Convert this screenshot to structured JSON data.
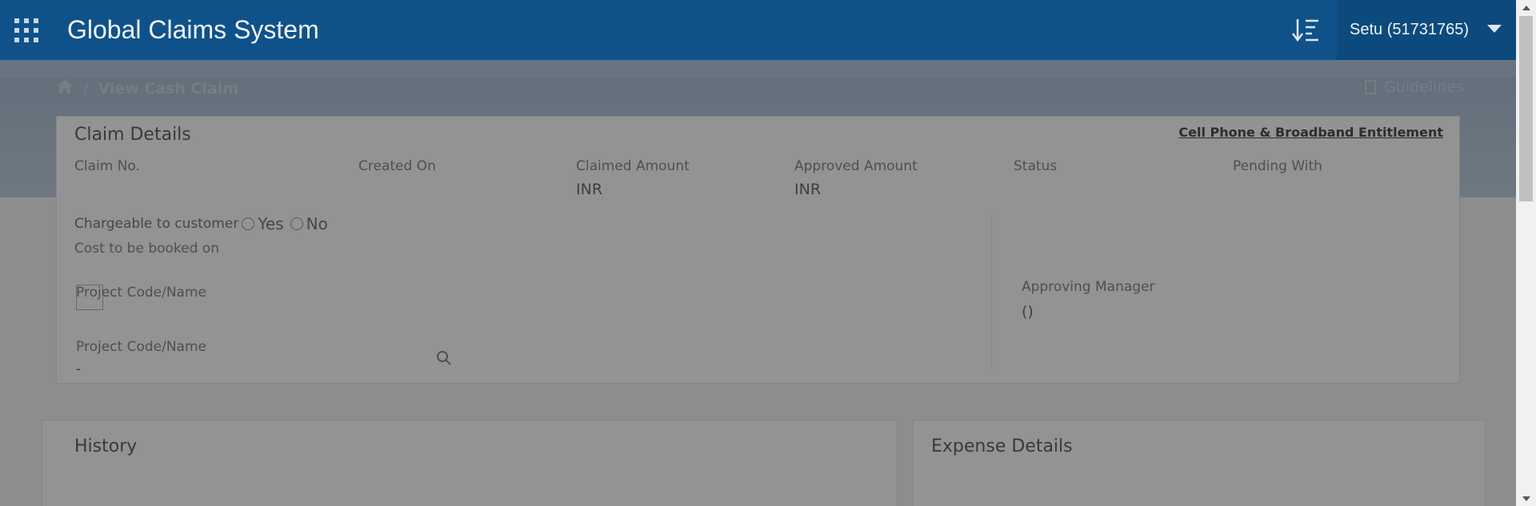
{
  "header": {
    "title": "Global Claims System",
    "user": "Setu (51731765)"
  },
  "breadcrumb": {
    "separator": "/",
    "current": "View Cash Claim"
  },
  "guidelines_label": "Guidelines",
  "claim_details": {
    "title": "Claim Details",
    "entitlement_link": "Cell Phone & Broadband Entitlement",
    "fields": {
      "claim_no": "Claim No.",
      "created_on": "Created On",
      "claimed_amount": "Claimed Amount",
      "approved_amount": "Approved Amount",
      "status": "Status",
      "pending_with": "Pending With"
    },
    "claimed_amount_value": "INR",
    "approved_amount_value": "INR",
    "chargeable_label": "Chargeable to customer",
    "yes_label": "Yes",
    "no_label": "No",
    "cost_booked_label": "Cost to be booked on",
    "project_code_label": "Project Code/Name",
    "project_code_label_2": "Project Code/Name",
    "project_code_value": "-",
    "approving_manager_label": "Approving Manager",
    "approving_manager_value": "()"
  },
  "history": {
    "title": "History"
  },
  "expense_details": {
    "title": "Expense Details"
  },
  "colors": {
    "header_bg": "#0f5289",
    "user_menu_bg": "#0c4a7d",
    "overlay": "rgba(40,40,40,0.5)"
  }
}
